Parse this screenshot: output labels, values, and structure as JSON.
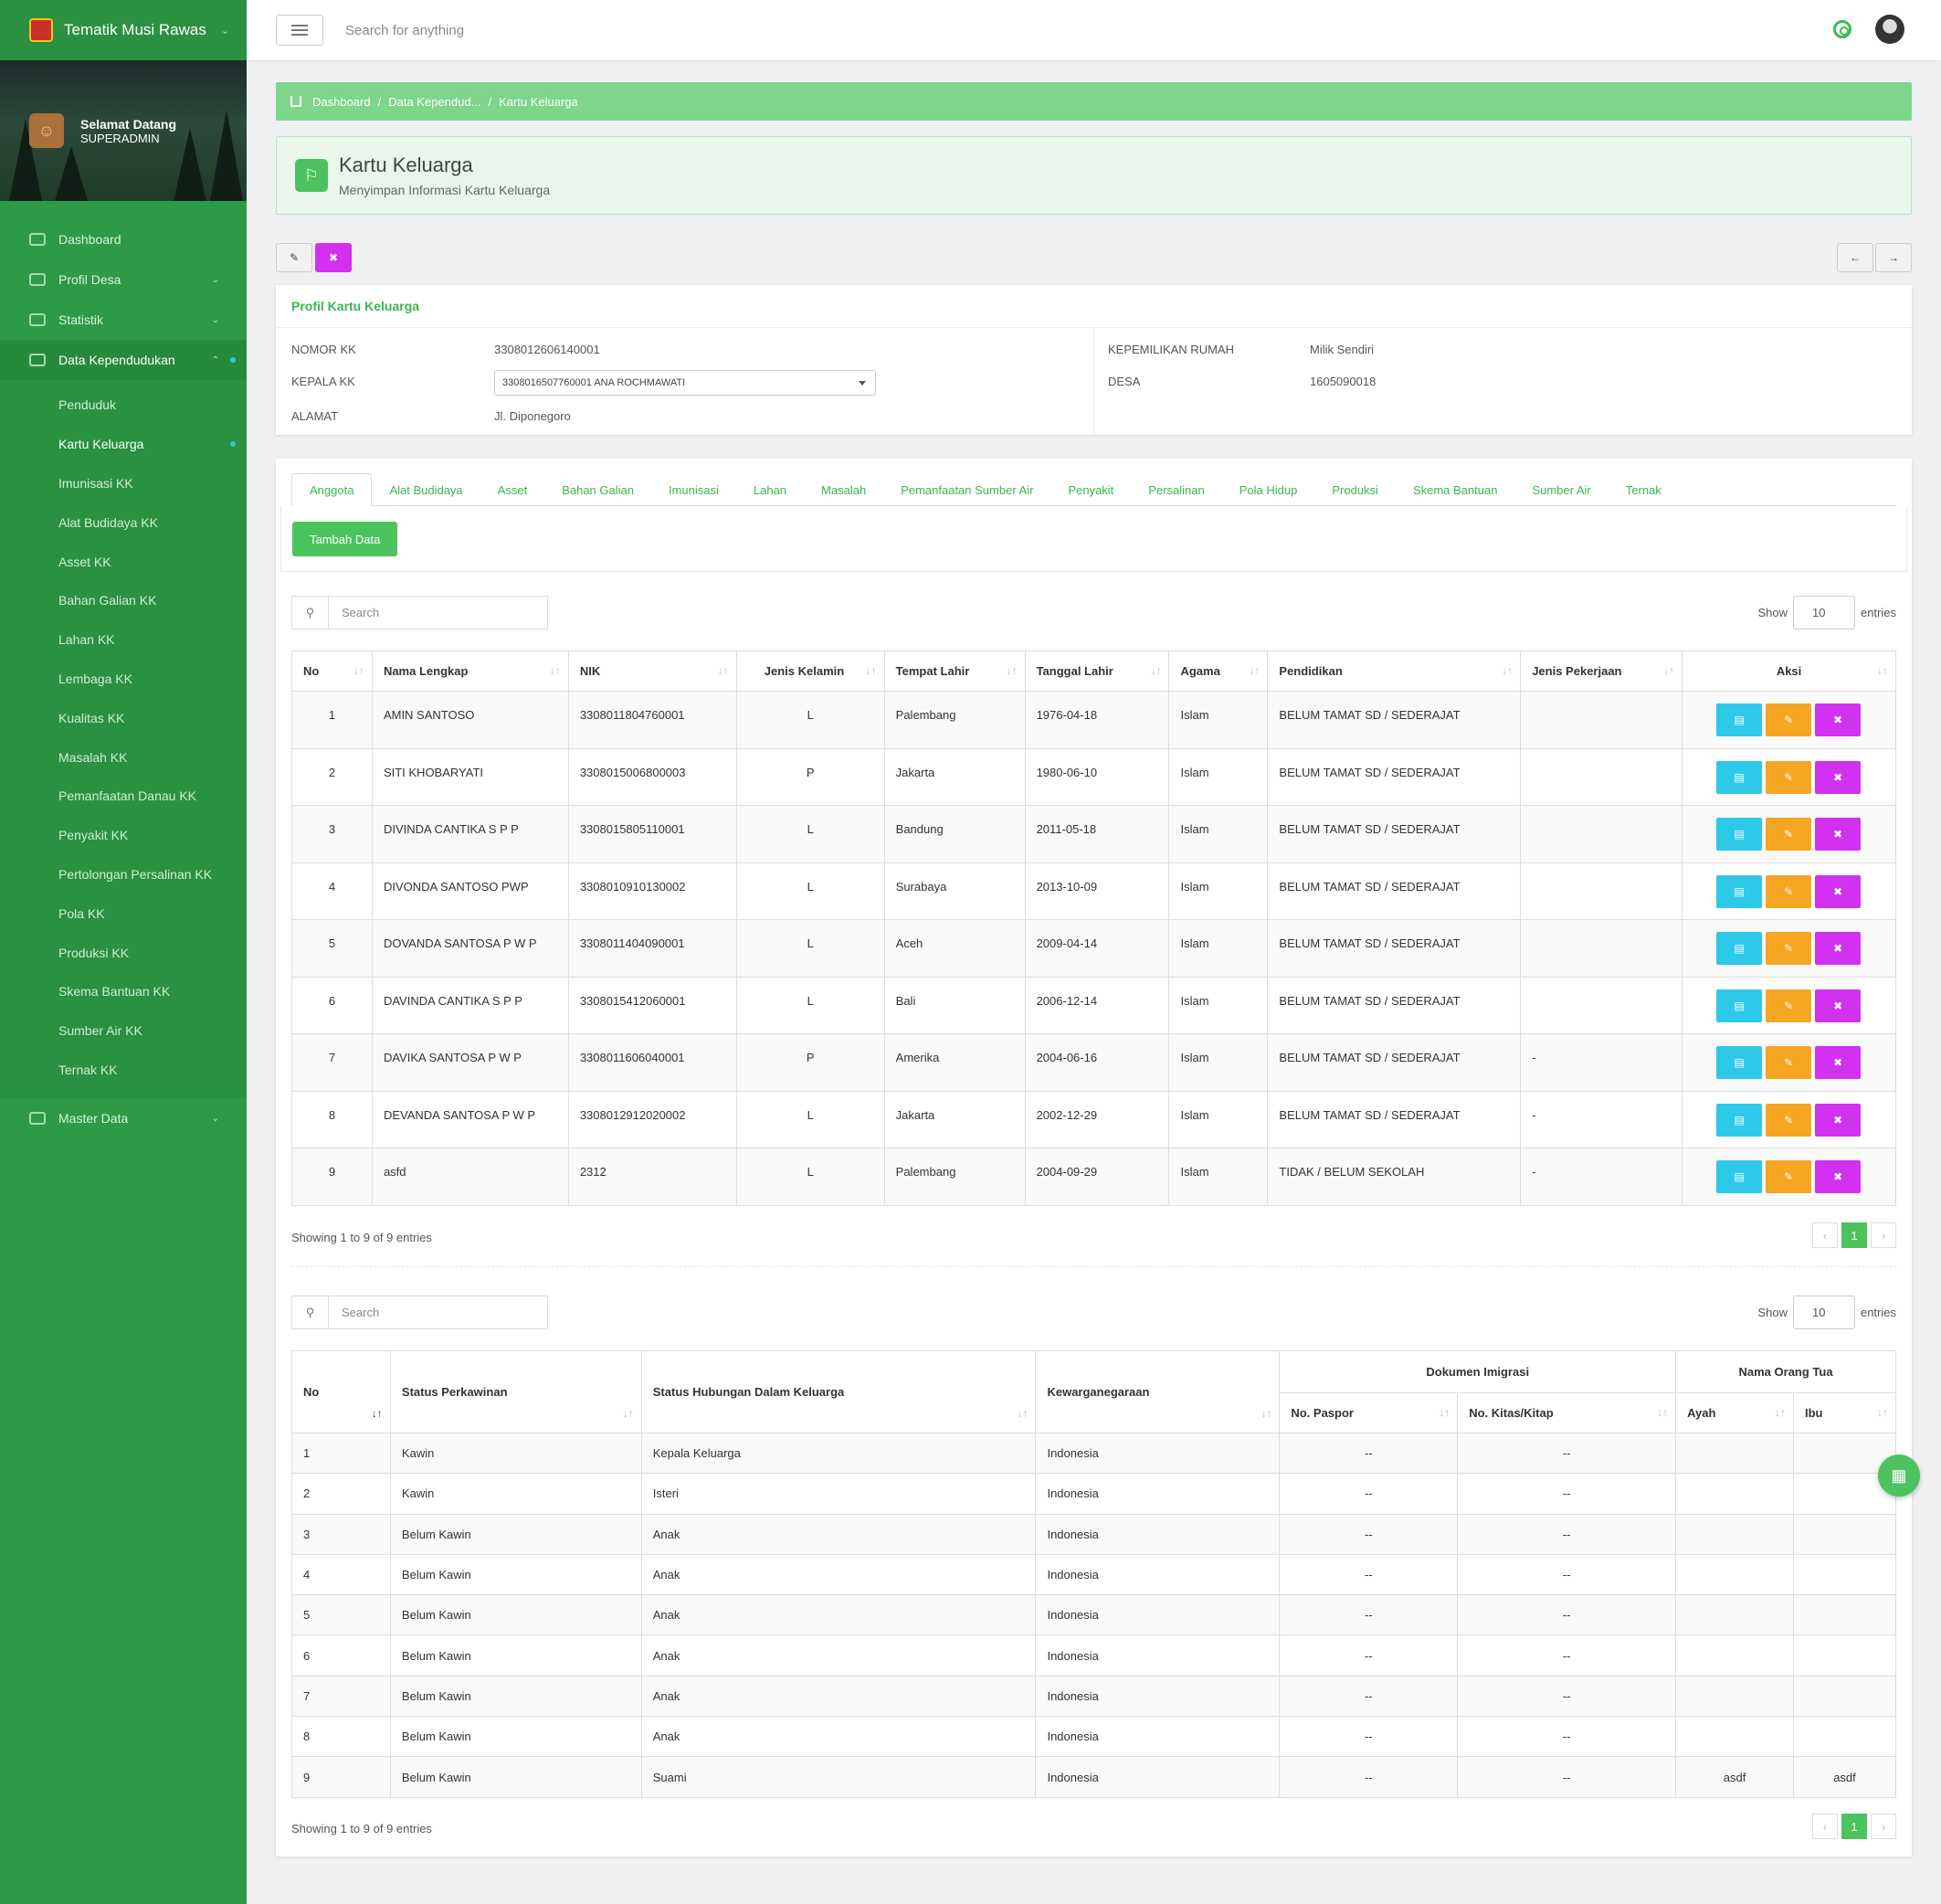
{
  "app": {
    "title": "Tematik Musi Rawas"
  },
  "welcome": {
    "greeting": "Selamat Datang",
    "user": "SUPERADMIN"
  },
  "sidebar": {
    "items": [
      {
        "label": "Dashboard"
      },
      {
        "label": "Profil Desa"
      },
      {
        "label": "Statistik"
      },
      {
        "label": "Data Kependudukan"
      },
      {
        "label": "Master Data"
      }
    ],
    "submenu": [
      "Penduduk",
      "Kartu Keluarga",
      "Imunisasi KK",
      "Alat Budidaya KK",
      "Asset KK",
      "Bahan Galian KK",
      "Lahan KK",
      "Lembaga KK",
      "Kualitas KK",
      "Masalah KK",
      "Pemanfaatan Danau KK",
      "Penyakit KK",
      "Pertolongan Persalinan KK",
      "Pola KK",
      "Produksi KK",
      "Skema Bantuan KK",
      "Sumber Air KK",
      "Ternak KK"
    ]
  },
  "topbar": {
    "search_placeholder": "Search for anything"
  },
  "breadcrumb": [
    "Dashboard",
    "Data Kependud...",
    "Kartu Keluarga"
  ],
  "page": {
    "title": "Kartu Keluarga",
    "subtitle": "Menyimpan Informasi Kartu Keluarga"
  },
  "profile": {
    "heading": "Profil Kartu Keluarga",
    "nomor_kk_label": "NOMOR KK",
    "nomor_kk": "3308012606140001",
    "kepala_kk_label": "KEPALA KK",
    "kepala_kk": "3308016507760001 ANA ROCHMAWATI",
    "alamat_label": "ALAMAT",
    "alamat": "Jl. Diponegoro",
    "rumah_label": "KEPEMILIKAN RUMAH",
    "rumah": "Milik Sendiri",
    "desa_label": "DESA",
    "desa": "1605090018"
  },
  "tabs": [
    "Anggota",
    "Alat Budidaya",
    "Asset",
    "Bahan Galian",
    "Imunisasi",
    "Lahan",
    "Masalah",
    "Pemanfaatan Sumber Air",
    "Penyakit",
    "Persalinan",
    "Pola Hidup",
    "Produksi",
    "Skema Bantuan",
    "Sumber Air",
    "Ternak"
  ],
  "tambah_label": "Tambah Data",
  "table_controls": {
    "search_placeholder": "Search",
    "show": "Show",
    "entries_value": "10",
    "entries": "entries",
    "info": "Showing 1 to 9 of 9 entries",
    "page": "1"
  },
  "table1": {
    "headers": [
      "No",
      "Nama Lengkap",
      "NIK",
      "Jenis Kelamin",
      "Tempat Lahir",
      "Tanggal Lahir",
      "Agama",
      "Pendidikan",
      "Jenis Pekerjaan",
      "Aksi"
    ],
    "rows": [
      [
        "1",
        "AMIN SANTOSO",
        "3308011804760001",
        "L",
        "Palembang",
        "1976-04-18",
        "Islam",
        "BELUM TAMAT SD / SEDERAJAT",
        ""
      ],
      [
        "2",
        "SITI KHOBARYATI",
        "3308015006800003",
        "P",
        "Jakarta",
        "1980-06-10",
        "Islam",
        "BELUM TAMAT SD / SEDERAJAT",
        ""
      ],
      [
        "3",
        "DIVINDA CANTIKA S P P",
        "3308015805110001",
        "L",
        "Bandung",
        "2011-05-18",
        "Islam",
        "BELUM TAMAT SD / SEDERAJAT",
        ""
      ],
      [
        "4",
        "DIVONDA SANTOSO PWP",
        "3308010910130002",
        "L",
        "Surabaya",
        "2013-10-09",
        "Islam",
        "BELUM TAMAT SD / SEDERAJAT",
        ""
      ],
      [
        "5",
        "DOVANDA SANTOSA P W P",
        "3308011404090001",
        "L",
        "Aceh",
        "2009-04-14",
        "Islam",
        "BELUM TAMAT SD / SEDERAJAT",
        ""
      ],
      [
        "6",
        "DAVINDA CANTIKA S P P",
        "3308015412060001",
        "L",
        "Bali",
        "2006-12-14",
        "Islam",
        "BELUM TAMAT SD / SEDERAJAT",
        ""
      ],
      [
        "7",
        "DAVIKA SANTOSA P W P",
        "3308011606040001",
        "P",
        "Amerika",
        "2004-06-16",
        "Islam",
        "BELUM TAMAT SD / SEDERAJAT",
        "-"
      ],
      [
        "8",
        "DEVANDA SANTOSA P W P",
        "3308012912020002",
        "L",
        "Jakarta",
        "2002-12-29",
        "Islam",
        "BELUM TAMAT SD / SEDERAJAT",
        "-"
      ],
      [
        "9",
        "asfd",
        "2312",
        "L",
        "Palembang",
        "2004-09-29",
        "Islam",
        "TIDAK / BELUM SEKOLAH",
        "-"
      ]
    ]
  },
  "table2": {
    "headers": {
      "no": "No",
      "status": "Status Perkawinan",
      "hubungan": "Status Hubungan Dalam Keluarga",
      "warga": "Kewarganegaraan",
      "imigrasi": "Dokumen Imigrasi",
      "paspor": "No. Paspor",
      "kitas": "No. Kitas/Kitap",
      "ortu": "Nama Orang Tua",
      "ayah": "Ayah",
      "ibu": "Ibu"
    },
    "rows": [
      [
        "1",
        "Kawin",
        "Kepala Keluarga",
        "Indonesia",
        "--",
        "--",
        "",
        ""
      ],
      [
        "2",
        "Kawin",
        "Isteri",
        "Indonesia",
        "--",
        "--",
        "",
        ""
      ],
      [
        "3",
        "Belum Kawin",
        "Anak",
        "Indonesia",
        "--",
        "--",
        "",
        ""
      ],
      [
        "4",
        "Belum Kawin",
        "Anak",
        "Indonesia",
        "--",
        "--",
        "",
        ""
      ],
      [
        "5",
        "Belum Kawin",
        "Anak",
        "Indonesia",
        "--",
        "--",
        "",
        ""
      ],
      [
        "6",
        "Belum Kawin",
        "Anak",
        "Indonesia",
        "--",
        "--",
        "",
        ""
      ],
      [
        "7",
        "Belum Kawin",
        "Anak",
        "Indonesia",
        "--",
        "--",
        "",
        ""
      ],
      [
        "8",
        "Belum Kawin",
        "Anak",
        "Indonesia",
        "--",
        "--",
        "",
        ""
      ],
      [
        "9",
        "Belum Kawin",
        "Suami",
        "Indonesia",
        "--",
        "--",
        "asdf",
        "asdf"
      ]
    ]
  },
  "colors": {
    "primary": "#4cc35f",
    "sidebar": "#2e9a45",
    "info": "#2ec9e8",
    "warning": "#f5a623",
    "danger": "#d231f0"
  }
}
